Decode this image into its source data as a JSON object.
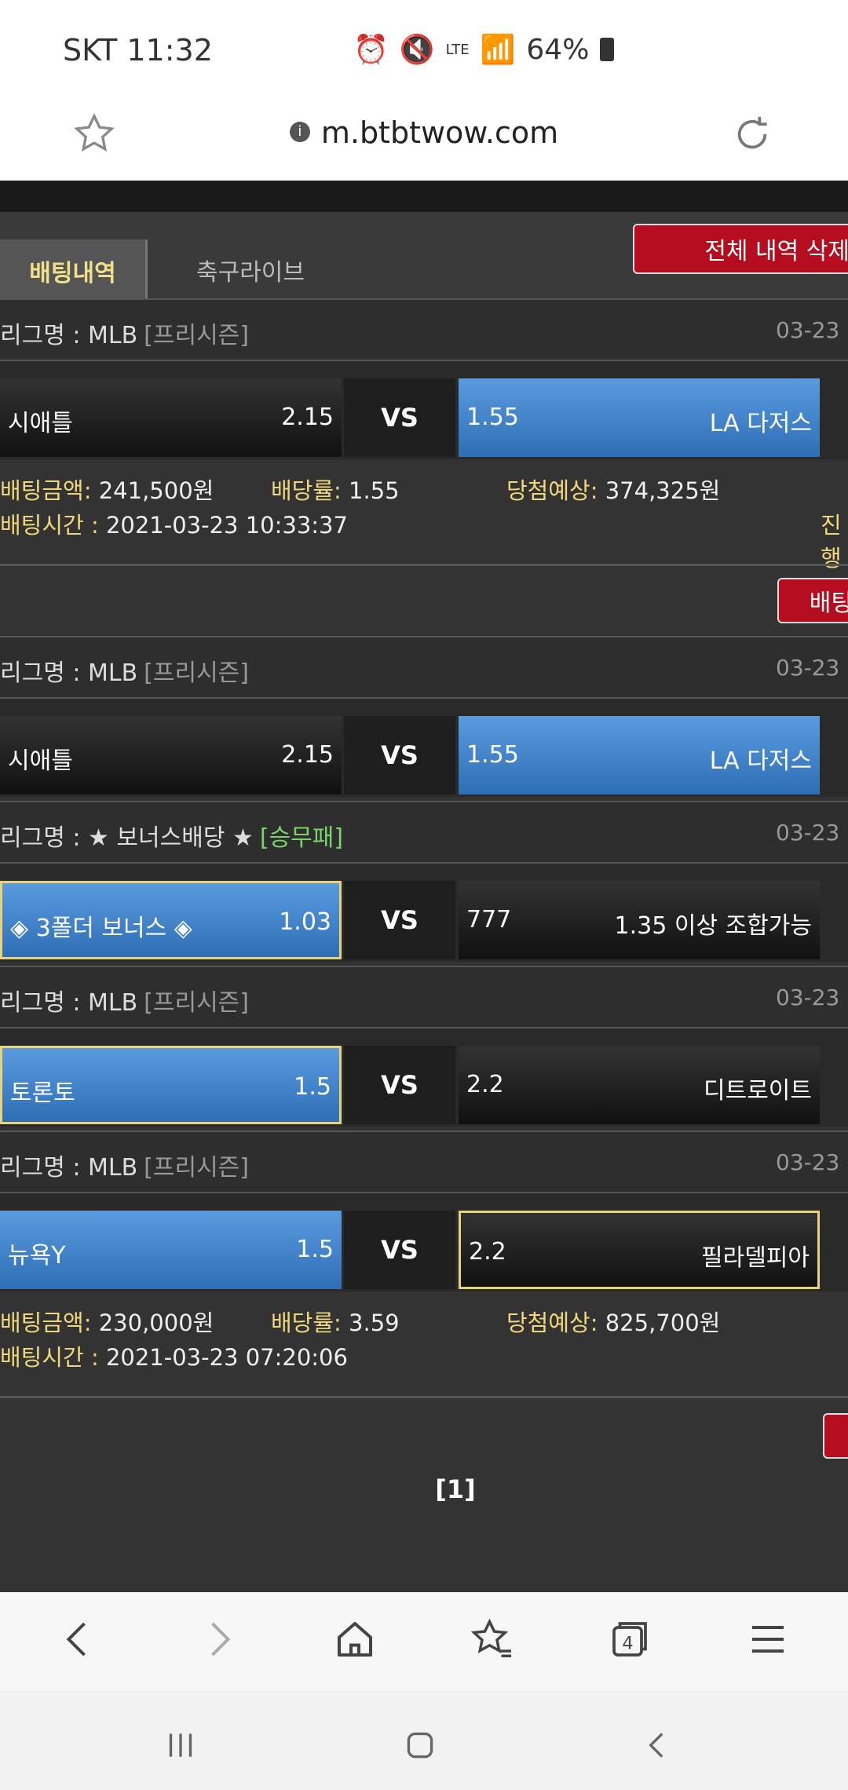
{
  "status_bar": {
    "carrier_time": "SKT 11:32",
    "network": "LTE",
    "battery": "64%",
    "icons": [
      "alarm-icon",
      "mute-icon",
      "lte-icon",
      "signal-icon",
      "battery-icon"
    ]
  },
  "browser": {
    "url": "m.btbtwow.com"
  },
  "tabs": {
    "active": "배팅내역",
    "other": "축구라이브",
    "delete_all": "전체 내역 삭제"
  },
  "bet_groups": [
    {
      "matches": [
        {
          "league_label": "리그명 : ",
          "league": "MLB",
          "tag": "[프리시즌]",
          "date": "03-23",
          "home": "시애틀",
          "home_odds": "2.15",
          "vs": "VS",
          "away_odds": "1.55",
          "away": "LA 다저스",
          "selected": "away"
        }
      ],
      "summary": {
        "amount_label": "배팅금액:",
        "amount": "241,500원",
        "rate_label": "배당률:",
        "rate": "1.55",
        "expected_label": "당첨예상:",
        "expected": "374,325원",
        "time_label": "배팅시간 :",
        "time": "2021-03-23 10:33:37",
        "status": "진행"
      },
      "action": "배팅"
    },
    {
      "matches": [
        {
          "league_label": "리그명 : ",
          "league": "MLB",
          "tag": "[프리시즌]",
          "date": "03-23",
          "home": "시애틀",
          "home_odds": "2.15",
          "vs": "VS",
          "away_odds": "1.55",
          "away": "LA 다저스",
          "selected": "away"
        },
        {
          "league_label": "리그명 : ",
          "league": "★ 보너스배당 ★",
          "tag": "[승무패]",
          "date": "03-23",
          "home": "◈ 3폴더 보너스 ◈",
          "home_odds": "1.03",
          "vs": "VS",
          "away_odds": "777",
          "away": "1.35 이상 조합가능",
          "selected": "home"
        },
        {
          "league_label": "리그명 : ",
          "league": "MLB",
          "tag": "[프리시즌]",
          "date": "03-23",
          "home": "토론토",
          "home_odds": "1.5",
          "vs": "VS",
          "away_odds": "2.2",
          "away": "디트로이트",
          "selected": "home"
        },
        {
          "league_label": "리그명 : ",
          "league": "MLB",
          "tag": "[프리시즌]",
          "date": "03-23",
          "home": "뉴욕Y",
          "home_odds": "1.5",
          "vs": "VS",
          "away_odds": "2.2",
          "away": "필라델피아",
          "selected": "home"
        }
      ],
      "summary": {
        "amount_label": "배팅금액:",
        "amount": "230,000원",
        "rate_label": "배당률:",
        "rate": "3.59",
        "expected_label": "당첨예상:",
        "expected": "825,700원",
        "time_label": "배팅시간 :",
        "time": "2021-03-23 07:20:06",
        "status": ""
      }
    }
  ],
  "pagination": "[1]",
  "bottom_nav": [
    "back-icon",
    "forward-icon",
    "home-icon",
    "bookmarks-icon",
    "tabs-icon",
    "menu-icon"
  ],
  "tab_count": "4",
  "colors": {
    "background": "#333333",
    "selected_blue": "#4a8ad4",
    "accent_yellow": "#f0d87a",
    "button_red": "#b50d1f"
  }
}
